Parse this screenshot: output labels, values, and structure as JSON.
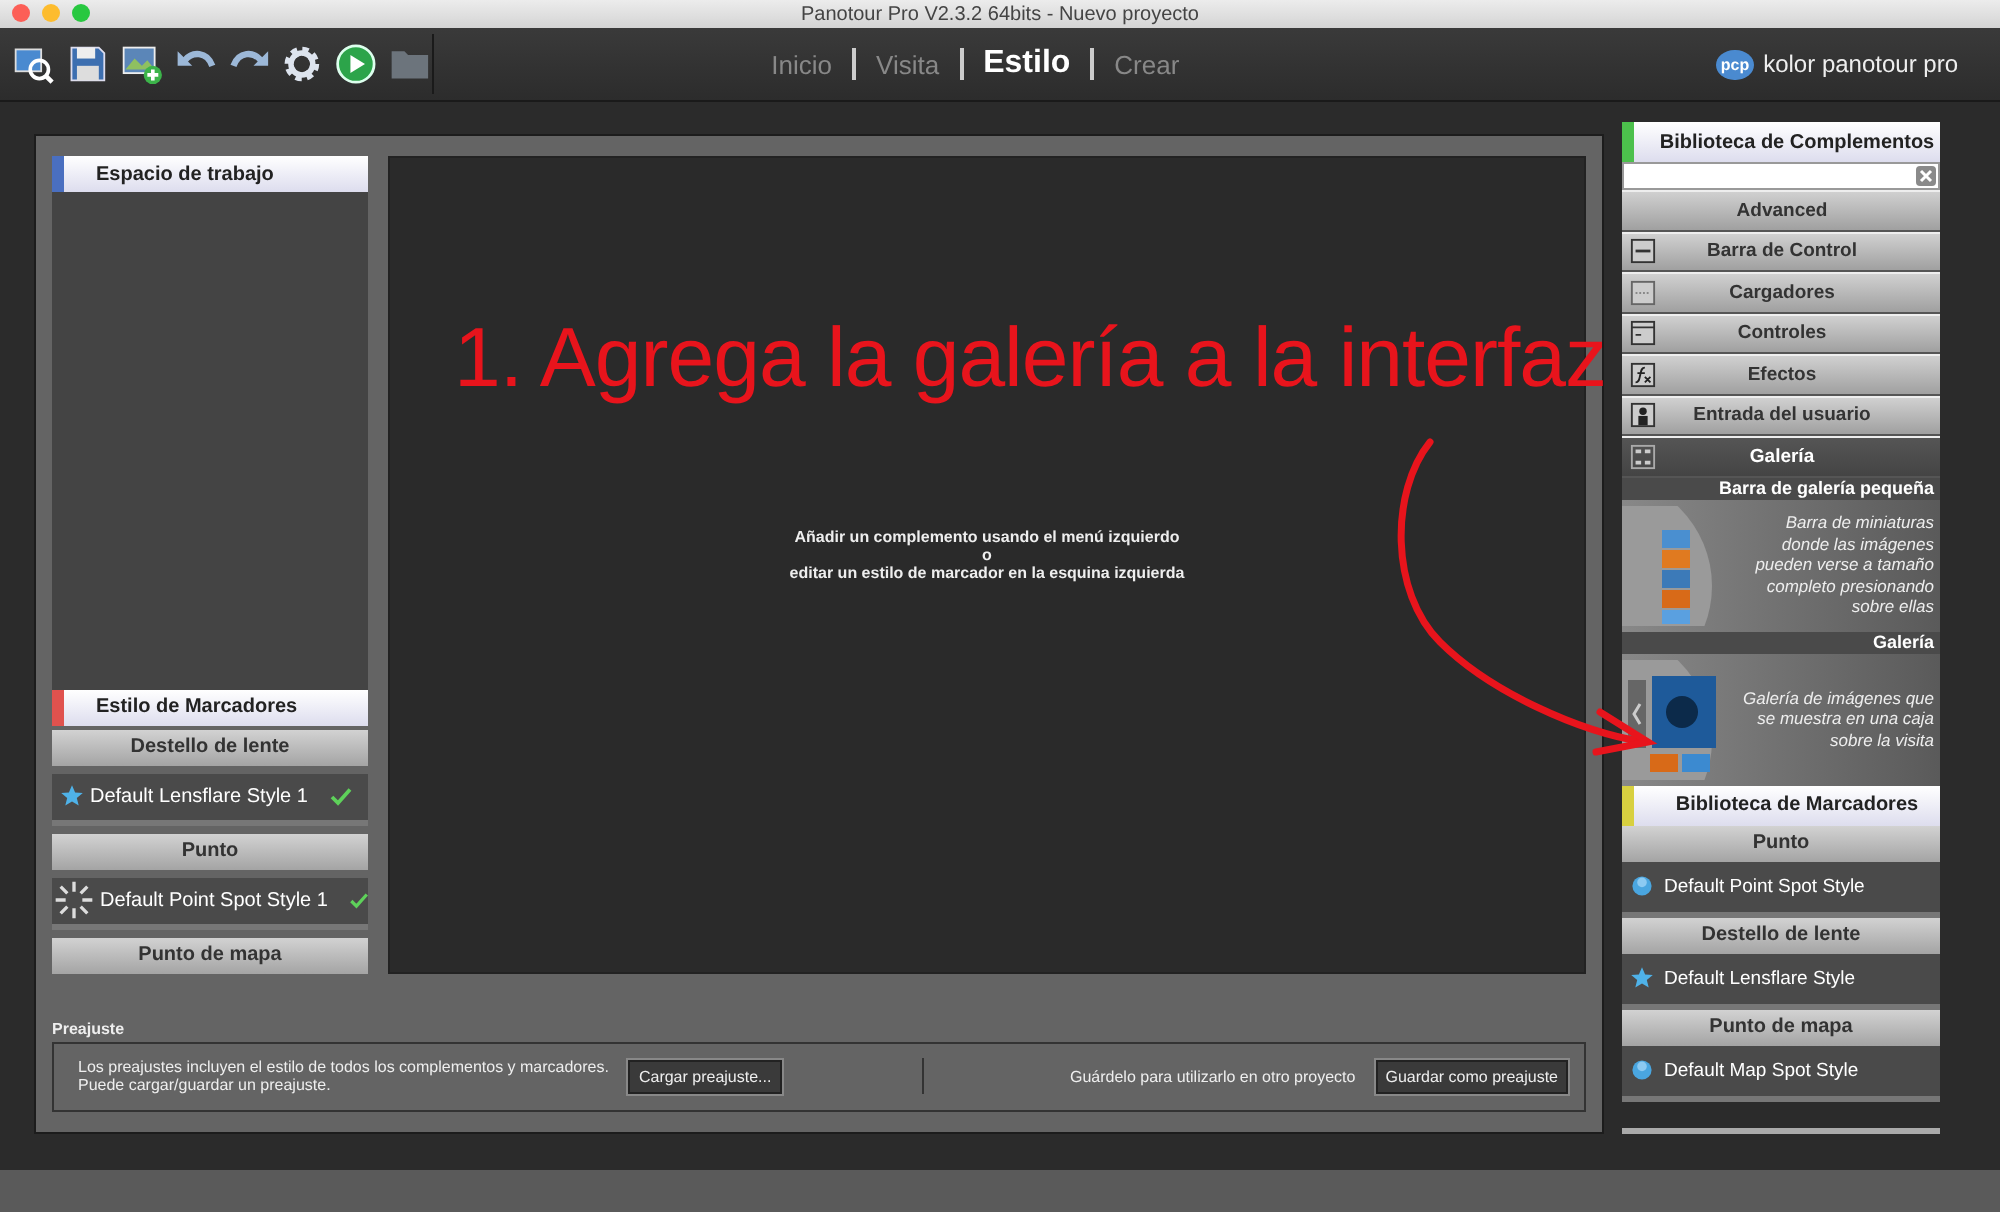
{
  "window": {
    "title": "Panotour Pro V2.3.2 64bits - Nuevo proyecto"
  },
  "tabs": [
    {
      "label": "Inicio",
      "selected": false
    },
    {
      "label": "Visita",
      "selected": false
    },
    {
      "label": "Estilo",
      "selected": true
    },
    {
      "label": "Crear",
      "selected": false
    }
  ],
  "brand": {
    "logo": "pcp",
    "name": "kolor panotour pro"
  },
  "left_panel": {
    "workspace_header": {
      "label": "Espacio de trabajo",
      "color": "#4a6fc0"
    },
    "markers_header": {
      "label": "Estilo de Marcadores",
      "color": "#e0524e"
    },
    "groups": [
      {
        "title": "Destello de lente",
        "items": [
          {
            "label": "Default Lensflare Style 1",
            "kind": "star",
            "checked": true
          }
        ]
      },
      {
        "title": "Punto",
        "items": [
          {
            "label": "Default Point Spot Style 1",
            "kind": "burst",
            "checked": true
          }
        ]
      },
      {
        "title": "Punto de mapa"
      }
    ]
  },
  "canvas": {
    "annotation": "1. Agrega la galería a la interfaz",
    "message": [
      "Añadir un complemento usando el menú izquierdo",
      "o",
      "editar un estilo de marcador en la esquina izquierda"
    ]
  },
  "right_panel": {
    "plugin_header": {
      "label": "Biblioteca de Complementos",
      "color": "#4cc04c"
    },
    "categories": [
      {
        "label": "Advanced",
        "kind": "none",
        "selected": false
      },
      {
        "label": "Barra de Control",
        "kind": "bar",
        "selected": false
      },
      {
        "label": "Cargadores",
        "kind": "loader",
        "selected": false
      },
      {
        "label": "Controles",
        "kind": "controls",
        "selected": false
      },
      {
        "label": "Efectos",
        "kind": "fx",
        "selected": false
      },
      {
        "label": "Entrada del usuario",
        "kind": "user",
        "selected": false
      },
      {
        "label": "Galería",
        "kind": "grid",
        "selected": true
      }
    ],
    "gallery": [
      {
        "title": "Barra de galería pequeña",
        "description": "Barra de miniaturas donde las imágenes pueden verse a tamaño completo presionando sobre ellas",
        "kind": "strip"
      },
      {
        "title": "Galería",
        "description": "Galería de imágenes que se muestra en una caja sobre la visita",
        "kind": "box"
      }
    ],
    "marker_header": {
      "label": "Biblioteca de Marcadores",
      "color": "#d8d040"
    },
    "groups": [
      {
        "title": "Punto",
        "items": [
          {
            "label": "Default Point Spot Style",
            "kind": "dot"
          }
        ]
      },
      {
        "title": "Destello de lente",
        "items": [
          {
            "label": "Default Lensflare Style",
            "kind": "star"
          }
        ]
      },
      {
        "title": "Punto de mapa",
        "items": [
          {
            "label": "Default Map Spot Style",
            "kind": "dot"
          }
        ]
      }
    ]
  },
  "preset": {
    "title": "Preajuste",
    "lines": [
      "Los preajustes incluyen el estilo de todos los complementos y marcadores.",
      "Puede cargar/guardar un preajuste."
    ],
    "load_button": "Cargar preajuste...",
    "save_hint": "Guárdelo para utilizarlo en otro proyecto",
    "save_button": "Guardar como preajuste"
  }
}
